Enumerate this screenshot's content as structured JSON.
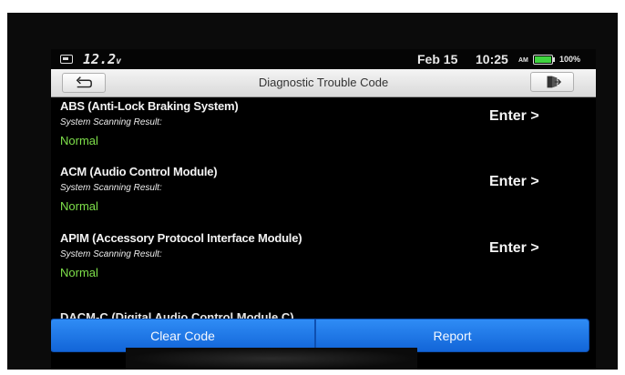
{
  "status_bar": {
    "voltage": "12.2",
    "voltage_unit": "v",
    "date": "Feb 15",
    "time": "10:25",
    "ampm": "AM",
    "battery_percent": "100%",
    "battery_level": 1.0,
    "battery_color": "#3fd43f"
  },
  "header": {
    "title": "Diagnostic Trouble Code",
    "back_icon": "back-arrow-icon",
    "exit_icon": "exit-door-icon"
  },
  "modules": [
    {
      "name": "ABS (Anti-Lock Braking System)",
      "subtitle": "System Scanning Result:",
      "result": "Normal",
      "action": "Enter >"
    },
    {
      "name": "ACM (Audio Control Module)",
      "subtitle": "System Scanning Result:",
      "result": "Normal",
      "action": "Enter >"
    },
    {
      "name": "APIM (Accessory Protocol Interface Module)",
      "subtitle": "System Scanning Result:",
      "result": "Normal",
      "action": "Enter >"
    }
  ],
  "partial_item": "DACM-C (Digital Audio Control Module C)",
  "footer": {
    "clear_code": "Clear Code",
    "report": "Report"
  },
  "colors": {
    "normal_status": "#7ee04a",
    "button_blue": "#1f78e8"
  }
}
